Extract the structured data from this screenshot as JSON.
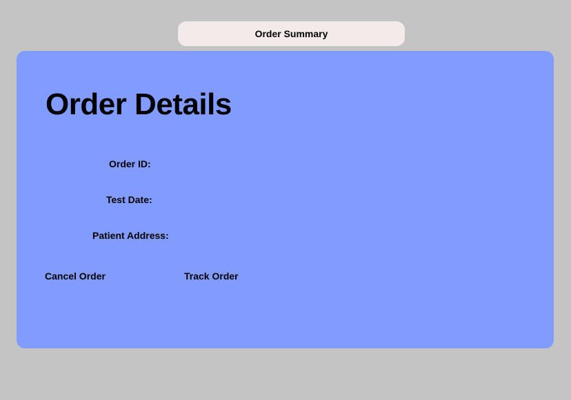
{
  "header": {
    "tab_label": "Order Summary"
  },
  "card": {
    "title": "Order Details",
    "fields": [
      {
        "label": "Order ID:"
      },
      {
        "label": "Test Date:"
      },
      {
        "label": "Patient Address:"
      }
    ],
    "actions": {
      "cancel_label": "Cancel Order",
      "track_label": "Track Order"
    }
  },
  "colors": {
    "background": "#c4c4c4",
    "tab_background": "#f3ebe9",
    "card_background": "#819cfe",
    "text": "#000000"
  }
}
